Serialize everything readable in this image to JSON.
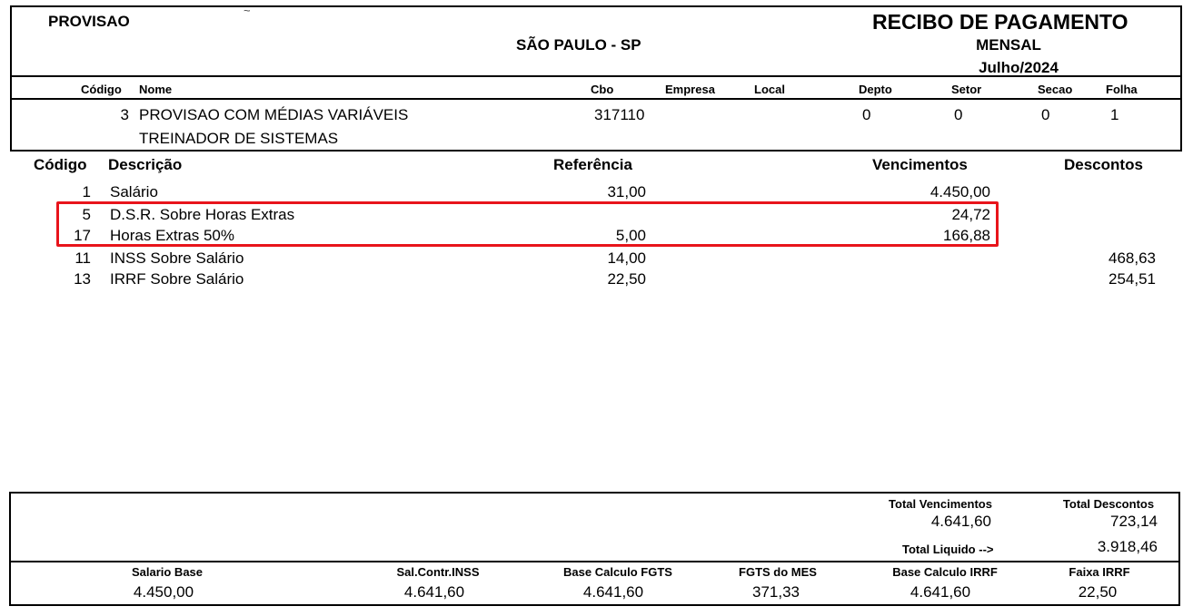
{
  "header": {
    "company": "PROVISAO",
    "mark": "~",
    "city": "SÃO PAULO - SP",
    "title": "RECIBO DE PAGAMENTO",
    "period_type": "MENSAL",
    "period": "Julho/2024"
  },
  "employee_header": {
    "codigo": "Código",
    "nome": "Nome",
    "cbo": "Cbo",
    "empresa": "Empresa",
    "local": "Local",
    "depto": "Depto",
    "setor": "Setor",
    "secao": "Secao",
    "folha": "Folha"
  },
  "employee": {
    "codigo": "3",
    "nome": "PROVISAO COM MÉDIAS VARIÁVEIS",
    "cargo": "TREINADOR DE SISTEMAS",
    "cbo": "317110",
    "depto": "0",
    "setor": "0",
    "secao": "0",
    "folha": "1"
  },
  "items_header": {
    "codigo": "Código",
    "descricao": "Descrição",
    "referencia": "Referência",
    "vencimentos": "Vencimentos",
    "descontos": "Descontos"
  },
  "items": [
    {
      "codigo": "1",
      "descricao": "Salário",
      "referencia": "31,00",
      "vencimentos": "4.450,00",
      "descontos": ""
    },
    {
      "codigo": "5",
      "descricao": "D.S.R. Sobre Horas Extras",
      "referencia": "",
      "vencimentos": "24,72",
      "descontos": ""
    },
    {
      "codigo": "17",
      "descricao": "Horas Extras 50%",
      "referencia": "5,00",
      "vencimentos": "166,88",
      "descontos": ""
    },
    {
      "codigo": "11",
      "descricao": "INSS Sobre Salário",
      "referencia": "14,00",
      "vencimentos": "",
      "descontos": "468,63"
    },
    {
      "codigo": "13",
      "descricao": "IRRF Sobre Salário",
      "referencia": "22,50",
      "vencimentos": "",
      "descontos": "254,51"
    }
  ],
  "totals": {
    "total_vencimentos_label": "Total Vencimentos",
    "total_vencimentos": "4.641,60",
    "total_descontos_label": "Total Descontos",
    "total_descontos": "723,14",
    "total_liquido_label": "Total Liquido -->",
    "total_liquido": "3.918,46"
  },
  "footer": {
    "salario_base_label": "Salario Base",
    "salario_base": "4.450,00",
    "sal_contr_inss_label": "Sal.Contr.INSS",
    "sal_contr_inss": "4.641,60",
    "base_fgts_label": "Base Calculo FGTS",
    "base_fgts": "4.641,60",
    "fgts_mes_label": "FGTS do MES",
    "fgts_mes": "371,33",
    "base_irrf_label": "Base Calculo IRRF",
    "base_irrf": "4.641,60",
    "faixa_irrf_label": "Faixa IRRF",
    "faixa_irrf": "22,50"
  },
  "colors": {
    "highlight": "#e8141b"
  }
}
